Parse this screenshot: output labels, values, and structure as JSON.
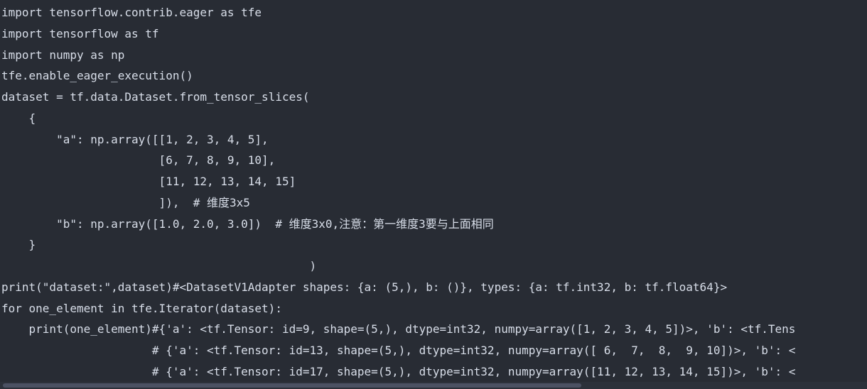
{
  "code": {
    "lines": [
      "import tensorflow.contrib.eager as tfe",
      "import tensorflow as tf",
      "import numpy as np",
      "tfe.enable_eager_execution()",
      "dataset = tf.data.Dataset.from_tensor_slices(",
      "    {",
      "        \"a\": np.array([[1, 2, 3, 4, 5],",
      "                       [6, 7, 8, 9, 10],",
      "                       [11, 12, 13, 14, 15]",
      "                       ]),  # 维度3x5",
      "        \"b\": np.array([1.0, 2.0, 3.0])  # 维度3x0,注意：第一维度3要与上面相同",
      "    }",
      "                                             )",
      "print(\"dataset:\",dataset)#<DatasetV1Adapter shapes: {a: (5,), b: ()}, types: {a: tf.int32, b: tf.float64}>",
      "for one_element in tfe.Iterator(dataset):",
      "    print(one_element)#{'a': <tf.Tensor: id=9, shape=(5,), dtype=int32, numpy=array([1, 2, 3, 4, 5])>, 'b': <tf.Tens",
      "                      # {'a': <tf.Tensor: id=13, shape=(5,), dtype=int32, numpy=array([ 6,  7,  8,  9, 10])>, 'b': <",
      "                      # {'a': <tf.Tensor: id=17, shape=(5,), dtype=int32, numpy=array([11, 12, 13, 14, 15])>, 'b': <"
    ]
  },
  "colors": {
    "background": "#282c34",
    "text": "#d8dee9",
    "scrollbar_thumb": "#4b5162"
  }
}
